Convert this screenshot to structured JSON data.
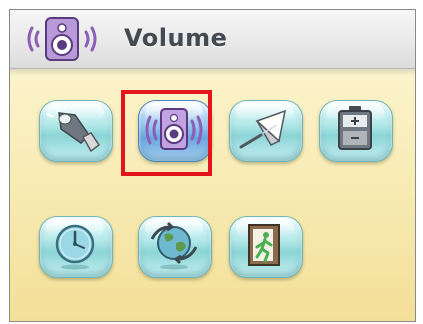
{
  "header": {
    "title": "Volume",
    "icon": "speaker-icon"
  },
  "menu": {
    "selected_item": "volume",
    "items": [
      {
        "id": "flashlight",
        "icon": "flashlight-icon"
      },
      {
        "id": "volume",
        "icon": "speaker-icon"
      },
      {
        "id": "calibration",
        "icon": "stylus-icon"
      },
      {
        "id": "battery",
        "icon": "battery-icon"
      },
      {
        "id": "clock",
        "icon": "clock-icon"
      },
      {
        "id": "globe",
        "icon": "globe-icon"
      },
      {
        "id": "exit",
        "icon": "exit-icon"
      }
    ]
  },
  "colors": {
    "highlight": "#e3141b",
    "button": "#8dd5d7",
    "selected_button": "#6aa7df",
    "title": "#444a52"
  }
}
